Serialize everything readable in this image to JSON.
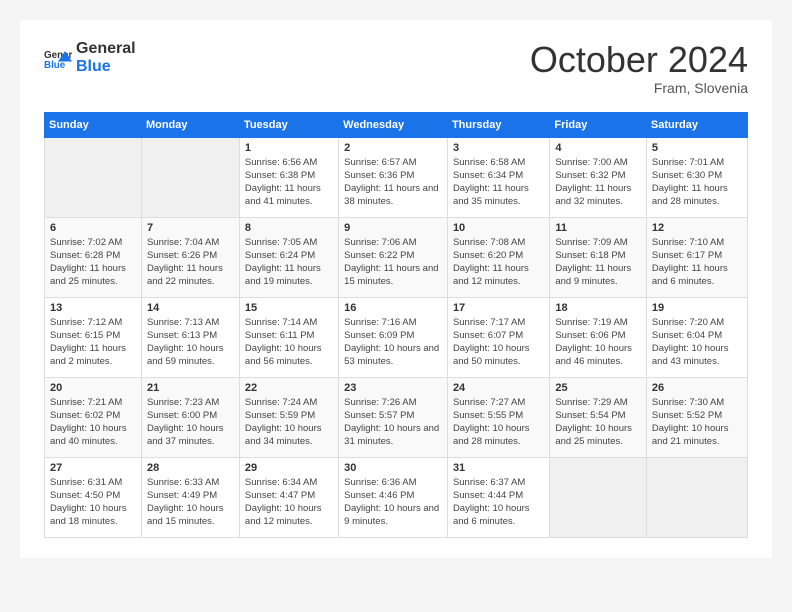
{
  "header": {
    "logo_general": "General",
    "logo_blue": "Blue",
    "title": "October 2024",
    "location": "Fram, Slovenia"
  },
  "days_of_week": [
    "Sunday",
    "Monday",
    "Tuesday",
    "Wednesday",
    "Thursday",
    "Friday",
    "Saturday"
  ],
  "weeks": [
    [
      {
        "day": "",
        "content": ""
      },
      {
        "day": "",
        "content": ""
      },
      {
        "day": "1",
        "content": "Sunrise: 6:56 AM\nSunset: 6:38 PM\nDaylight: 11 hours and 41 minutes."
      },
      {
        "day": "2",
        "content": "Sunrise: 6:57 AM\nSunset: 6:36 PM\nDaylight: 11 hours and 38 minutes."
      },
      {
        "day": "3",
        "content": "Sunrise: 6:58 AM\nSunset: 6:34 PM\nDaylight: 11 hours and 35 minutes."
      },
      {
        "day": "4",
        "content": "Sunrise: 7:00 AM\nSunset: 6:32 PM\nDaylight: 11 hours and 32 minutes."
      },
      {
        "day": "5",
        "content": "Sunrise: 7:01 AM\nSunset: 6:30 PM\nDaylight: 11 hours and 28 minutes."
      }
    ],
    [
      {
        "day": "6",
        "content": "Sunrise: 7:02 AM\nSunset: 6:28 PM\nDaylight: 11 hours and 25 minutes."
      },
      {
        "day": "7",
        "content": "Sunrise: 7:04 AM\nSunset: 6:26 PM\nDaylight: 11 hours and 22 minutes."
      },
      {
        "day": "8",
        "content": "Sunrise: 7:05 AM\nSunset: 6:24 PM\nDaylight: 11 hours and 19 minutes."
      },
      {
        "day": "9",
        "content": "Sunrise: 7:06 AM\nSunset: 6:22 PM\nDaylight: 11 hours and 15 minutes."
      },
      {
        "day": "10",
        "content": "Sunrise: 7:08 AM\nSunset: 6:20 PM\nDaylight: 11 hours and 12 minutes."
      },
      {
        "day": "11",
        "content": "Sunrise: 7:09 AM\nSunset: 6:18 PM\nDaylight: 11 hours and 9 minutes."
      },
      {
        "day": "12",
        "content": "Sunrise: 7:10 AM\nSunset: 6:17 PM\nDaylight: 11 hours and 6 minutes."
      }
    ],
    [
      {
        "day": "13",
        "content": "Sunrise: 7:12 AM\nSunset: 6:15 PM\nDaylight: 11 hours and 2 minutes."
      },
      {
        "day": "14",
        "content": "Sunrise: 7:13 AM\nSunset: 6:13 PM\nDaylight: 10 hours and 59 minutes."
      },
      {
        "day": "15",
        "content": "Sunrise: 7:14 AM\nSunset: 6:11 PM\nDaylight: 10 hours and 56 minutes."
      },
      {
        "day": "16",
        "content": "Sunrise: 7:16 AM\nSunset: 6:09 PM\nDaylight: 10 hours and 53 minutes."
      },
      {
        "day": "17",
        "content": "Sunrise: 7:17 AM\nSunset: 6:07 PM\nDaylight: 10 hours and 50 minutes."
      },
      {
        "day": "18",
        "content": "Sunrise: 7:19 AM\nSunset: 6:06 PM\nDaylight: 10 hours and 46 minutes."
      },
      {
        "day": "19",
        "content": "Sunrise: 7:20 AM\nSunset: 6:04 PM\nDaylight: 10 hours and 43 minutes."
      }
    ],
    [
      {
        "day": "20",
        "content": "Sunrise: 7:21 AM\nSunset: 6:02 PM\nDaylight: 10 hours and 40 minutes."
      },
      {
        "day": "21",
        "content": "Sunrise: 7:23 AM\nSunset: 6:00 PM\nDaylight: 10 hours and 37 minutes."
      },
      {
        "day": "22",
        "content": "Sunrise: 7:24 AM\nSunset: 5:59 PM\nDaylight: 10 hours and 34 minutes."
      },
      {
        "day": "23",
        "content": "Sunrise: 7:26 AM\nSunset: 5:57 PM\nDaylight: 10 hours and 31 minutes."
      },
      {
        "day": "24",
        "content": "Sunrise: 7:27 AM\nSunset: 5:55 PM\nDaylight: 10 hours and 28 minutes."
      },
      {
        "day": "25",
        "content": "Sunrise: 7:29 AM\nSunset: 5:54 PM\nDaylight: 10 hours and 25 minutes."
      },
      {
        "day": "26",
        "content": "Sunrise: 7:30 AM\nSunset: 5:52 PM\nDaylight: 10 hours and 21 minutes."
      }
    ],
    [
      {
        "day": "27",
        "content": "Sunrise: 6:31 AM\nSunset: 4:50 PM\nDaylight: 10 hours and 18 minutes."
      },
      {
        "day": "28",
        "content": "Sunrise: 6:33 AM\nSunset: 4:49 PM\nDaylight: 10 hours and 15 minutes."
      },
      {
        "day": "29",
        "content": "Sunrise: 6:34 AM\nSunset: 4:47 PM\nDaylight: 10 hours and 12 minutes."
      },
      {
        "day": "30",
        "content": "Sunrise: 6:36 AM\nSunset: 4:46 PM\nDaylight: 10 hours and 9 minutes."
      },
      {
        "day": "31",
        "content": "Sunrise: 6:37 AM\nSunset: 4:44 PM\nDaylight: 10 hours and 6 minutes."
      },
      {
        "day": "",
        "content": ""
      },
      {
        "day": "",
        "content": ""
      }
    ]
  ]
}
